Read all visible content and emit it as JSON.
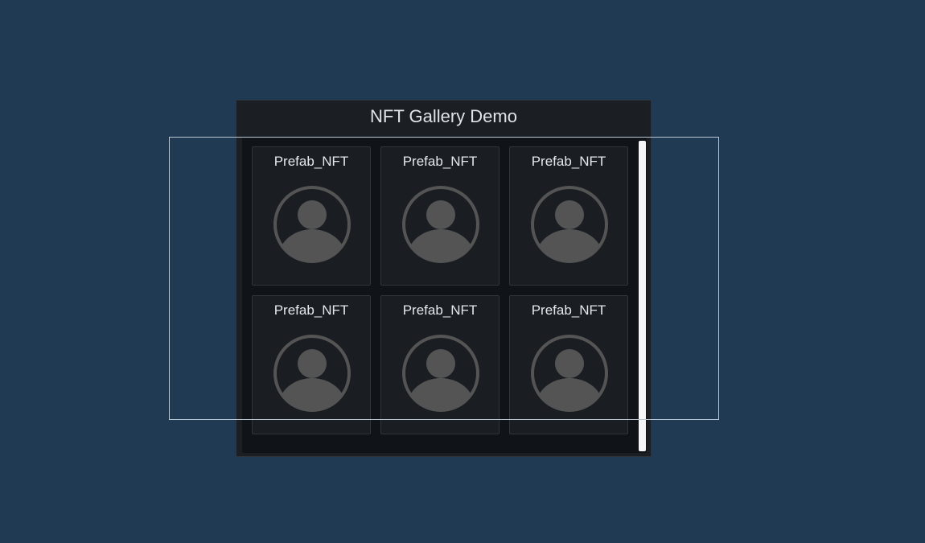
{
  "gallery": {
    "title": "NFT Gallery Demo",
    "items": [
      {
        "label": "Prefab_NFT",
        "icon": "user-avatar-icon"
      },
      {
        "label": "Prefab_NFT",
        "icon": "user-avatar-icon"
      },
      {
        "label": "Prefab_NFT",
        "icon": "user-avatar-icon"
      },
      {
        "label": "Prefab_NFT",
        "icon": "user-avatar-icon"
      },
      {
        "label": "Prefab_NFT",
        "icon": "user-avatar-icon"
      },
      {
        "label": "Prefab_NFT",
        "icon": "user-avatar-icon"
      }
    ]
  },
  "colors": {
    "background": "#213a53",
    "panel": "#1b1f24",
    "scroll_area": "#101317",
    "card": "#1a1e23",
    "avatar": "#545454",
    "scrollbar": "#f4f6f8",
    "selection_outline": "#b9c6d3"
  }
}
